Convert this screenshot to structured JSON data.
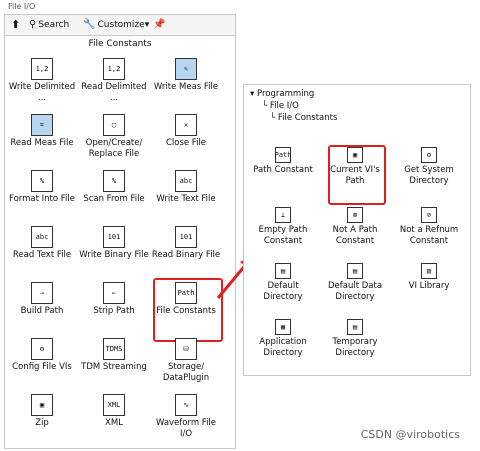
{
  "window": {
    "title": "File I/O"
  },
  "toolbar": {
    "search_label": "Search",
    "customize_label": "Customize▾"
  },
  "left_palette": {
    "header": "File Constants",
    "items": [
      {
        "label": "Write Delimited ...",
        "glyph": "1,2"
      },
      {
        "label": "Read Delimited ...",
        "glyph": "1,2"
      },
      {
        "label": "Write Meas File",
        "glyph": "✎"
      },
      {
        "label": "Read Meas File",
        "glyph": "⌗"
      },
      {
        "label": "Open/Create/ Replace File",
        "glyph": "▢"
      },
      {
        "label": "Close File",
        "glyph": "✕"
      },
      {
        "label": "Format Into File",
        "glyph": "%"
      },
      {
        "label": "Scan From File",
        "glyph": "%"
      },
      {
        "label": "Write Text File",
        "glyph": "abc"
      },
      {
        "label": "Read Text File",
        "glyph": "abc"
      },
      {
        "label": "Write Binary File",
        "glyph": "101"
      },
      {
        "label": "Read Binary File",
        "glyph": "101"
      },
      {
        "label": "Build Path",
        "glyph": "⇢"
      },
      {
        "label": "Strip Path",
        "glyph": "⇠"
      },
      {
        "label": "File Constants",
        "glyph": "Path"
      },
      {
        "label": "Config File VIs",
        "glyph": "⚙"
      },
      {
        "label": "TDM Streaming",
        "glyph": "TDMS"
      },
      {
        "label": "Storage/ DataPlugin",
        "glyph": "⛁"
      },
      {
        "label": "Zip",
        "glyph": "▣"
      },
      {
        "label": "XML",
        "glyph": "XML"
      },
      {
        "label": "Waveform File I/O",
        "glyph": "∿"
      }
    ]
  },
  "right_palette": {
    "tree": {
      "root": "Programming",
      "level1": "File I/O",
      "level2": "File Constants"
    },
    "items": [
      {
        "label": "Path Constant",
        "glyph": "Path"
      },
      {
        "label": "Current VI's Path",
        "glyph": "▣"
      },
      {
        "label": "Get System Directory",
        "glyph": "⚙"
      },
      {
        "label": "Empty Path Constant",
        "glyph": "⊥"
      },
      {
        "label": "Not A Path Constant",
        "glyph": "⊠"
      },
      {
        "label": "Not a Refnum Constant",
        "glyph": "⊘"
      },
      {
        "label": "Default Directory",
        "glyph": "▤"
      },
      {
        "label": "Default Data Directory",
        "glyph": "▤"
      },
      {
        "label": "VI Library",
        "glyph": "▥"
      },
      {
        "label": "Application Directory",
        "glyph": "▦"
      },
      {
        "label": "Temporary Directory",
        "glyph": "▤"
      }
    ]
  },
  "watermark": "CSDN @virobotics",
  "colors": {
    "highlight": "#e02020",
    "selection": "#b8d6f2"
  }
}
